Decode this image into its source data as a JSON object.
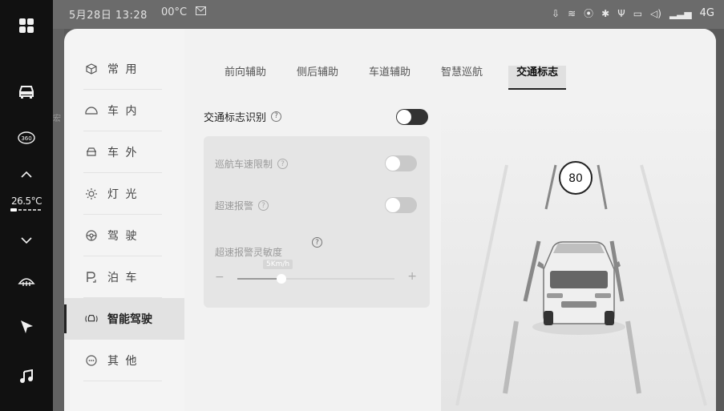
{
  "status": {
    "time": "5月28日 13:28",
    "temperature": "00°C",
    "message_icon": "message-icon",
    "network": "4G",
    "icons": [
      "download-icon",
      "wifi-icon",
      "hotspot-icon",
      "bluetooth-icon",
      "usb-icon",
      "screen-icon",
      "volume-icon",
      "signal-icon"
    ]
  },
  "rail": {
    "buttons": [
      "apps-icon",
      "car-icon",
      "360-icon",
      "chevron-up-icon",
      "chevron-down-icon",
      "defrost-icon",
      "navigation-icon",
      "music-icon"
    ],
    "badge_360": "360",
    "temperature": "26.5°C",
    "fan_level": 1
  },
  "map": {
    "side_label": "宏"
  },
  "sidebar": {
    "items": [
      {
        "label": "常 用",
        "icon": "cube-icon",
        "glyph": "◇"
      },
      {
        "label": "车 内",
        "icon": "car-seat-icon",
        "glyph": "◠"
      },
      {
        "label": "车 外",
        "icon": "car-exterior-icon",
        "glyph": "⌓"
      },
      {
        "label": "灯 光",
        "icon": "light-icon",
        "glyph": "☼"
      },
      {
        "label": "驾 驶",
        "icon": "steering-wheel-icon",
        "glyph": "⊛"
      },
      {
        "label": "泊 车",
        "icon": "parking-icon",
        "glyph": "P"
      },
      {
        "label": "智能驾驶",
        "icon": "smart-drive-icon",
        "glyph": "◎"
      },
      {
        "label": "其 他",
        "icon": "more-icon",
        "glyph": "⊙"
      }
    ],
    "active_index": 6
  },
  "tabs": [
    "前向辅助",
    "侧后辅助",
    "车道辅助",
    "智慧巡航",
    "交通标志"
  ],
  "active_tab": 4,
  "traffic_sign": {
    "label": "交通标志识别",
    "help_glyph": "?",
    "enabled": true
  },
  "sub_settings": {
    "cruise_limit": {
      "label": "巡航车速限制",
      "enabled": false
    },
    "overspeed_alert": {
      "label": "超速报警",
      "enabled": false
    },
    "sensitivity": {
      "label": "超速报警灵敏度",
      "value_label": "5Km/h",
      "minus": "−",
      "plus": "+",
      "level_fraction": 0.28
    }
  },
  "visual": {
    "speed_sign": "80"
  }
}
